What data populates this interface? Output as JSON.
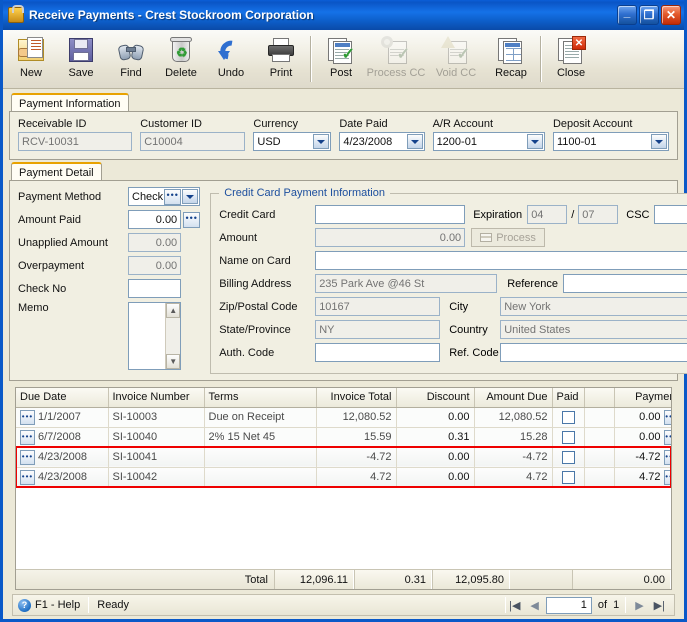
{
  "window": {
    "title": "Receive Payments - Crest Stockroom Corporation",
    "minimize": "_",
    "maximize": "❐",
    "close": "✕"
  },
  "toolbar": {
    "buttons": [
      {
        "label": "New",
        "icon": "new-document-icon",
        "disabled": false
      },
      {
        "label": "Save",
        "icon": "floppy-disk-icon",
        "disabled": false
      },
      {
        "label": "Find",
        "icon": "binoculars-icon",
        "disabled": false
      },
      {
        "label": "Delete",
        "icon": "recycle-bin-icon",
        "disabled": false
      },
      {
        "label": "Undo",
        "icon": "undo-arrow-icon",
        "disabled": false
      },
      {
        "label": "Print",
        "icon": "printer-icon",
        "disabled": false
      },
      {
        "label": "Post",
        "icon": "post-check-icon",
        "disabled": false
      },
      {
        "label": "Process CC",
        "icon": "process-cc-icon",
        "disabled": true
      },
      {
        "label": "Void CC",
        "icon": "void-cc-icon",
        "disabled": true
      },
      {
        "label": "Recap",
        "icon": "recap-grid-icon",
        "disabled": false
      },
      {
        "label": "Close",
        "icon": "close-window-icon",
        "disabled": false
      }
    ]
  },
  "tabs": {
    "payment_information": "Payment Information",
    "payment_detail": "Payment Detail"
  },
  "header_fields": {
    "receivable_id": {
      "label": "Receivable ID",
      "value": "RCV-10031"
    },
    "customer_id": {
      "label": "Customer ID",
      "value": "C10004"
    },
    "currency": {
      "label": "Currency",
      "value": "USD"
    },
    "date_paid": {
      "label": "Date Paid",
      "value": "4/23/2008"
    },
    "ar_account": {
      "label": "A/R Account",
      "value": "1200-01"
    },
    "deposit_account": {
      "label": "Deposit Account",
      "value": "1100-01"
    }
  },
  "payment_detail": {
    "payment_method": {
      "label": "Payment Method",
      "value": "Check"
    },
    "amount_paid": {
      "label": "Amount Paid",
      "value": "0.00"
    },
    "unapplied_amount": {
      "label": "Unapplied Amount",
      "value": "0.00"
    },
    "overpayment": {
      "label": "Overpayment",
      "value": "0.00"
    },
    "check_no": {
      "label": "Check No",
      "value": ""
    },
    "memo": {
      "label": "Memo",
      "value": ""
    }
  },
  "credit_card": {
    "legend": "Credit Card Payment Information",
    "credit_card": {
      "label": "Credit Card",
      "value": ""
    },
    "expiration": {
      "label": "Expiration",
      "month": "04",
      "separator": "/",
      "year": "07"
    },
    "csc": {
      "label": "CSC",
      "value": ""
    },
    "amount": {
      "label": "Amount",
      "value": "0.00"
    },
    "process_button": "Process",
    "name_on_card": {
      "label": "Name on Card",
      "value": ""
    },
    "billing_address": {
      "label": "Billing Address",
      "value": "235 Park Ave @46 St"
    },
    "reference": {
      "label": "Reference",
      "value": ""
    },
    "zip_postal_code": {
      "label": "Zip/Postal Code",
      "value": "10167"
    },
    "city": {
      "label": "City",
      "value": "New York"
    },
    "state_province": {
      "label": "State/Province",
      "value": "NY"
    },
    "country": {
      "label": "Country",
      "value": "United States"
    },
    "auth_code": {
      "label": "Auth. Code",
      "value": ""
    },
    "ref_code": {
      "label": "Ref. Code",
      "value": ""
    }
  },
  "grid": {
    "columns": [
      "Due Date",
      "Invoice Number",
      "Terms",
      "Invoice Total",
      "Discount",
      "Amount Due",
      "Paid",
      "",
      "Payment"
    ],
    "rows": [
      {
        "due_date": "1/1/2007",
        "invoice_number": "SI-10003",
        "terms": "Due on Receipt",
        "invoice_total": "12,080.52",
        "discount": "0.00",
        "amount_due": "12,080.52",
        "paid": false,
        "payment": "0.00",
        "highlighted": false
      },
      {
        "due_date": "6/7/2008",
        "invoice_number": "SI-10040",
        "terms": "2% 15 Net 45",
        "invoice_total": "15.59",
        "discount": "0.31",
        "amount_due": "15.28",
        "paid": false,
        "payment": "0.00",
        "highlighted": false
      },
      {
        "due_date": "4/23/2008",
        "invoice_number": "SI-10041",
        "terms": "",
        "invoice_total": "-4.72",
        "discount": "0.00",
        "amount_due": "-4.72",
        "paid": false,
        "payment": "-4.72",
        "highlighted": true
      },
      {
        "due_date": "4/23/2008",
        "invoice_number": "SI-10042",
        "terms": "",
        "invoice_total": "4.72",
        "discount": "0.00",
        "amount_due": "4.72",
        "paid": false,
        "payment": "4.72",
        "highlighted": true
      }
    ],
    "totals": {
      "label": "Total",
      "invoice_total": "12,096.11",
      "discount": "0.31",
      "amount_due": "12,095.80",
      "payment": "0.00"
    },
    "highlight_color": "#ee0000"
  },
  "statusbar": {
    "help": "F1 - Help",
    "help_icon": "question-mark-icon",
    "status": "Ready",
    "nav": {
      "first": "|◀",
      "prev": "◀",
      "current": "1",
      "of": "of",
      "total": "1",
      "next": "▶",
      "last": "▶|"
    }
  }
}
